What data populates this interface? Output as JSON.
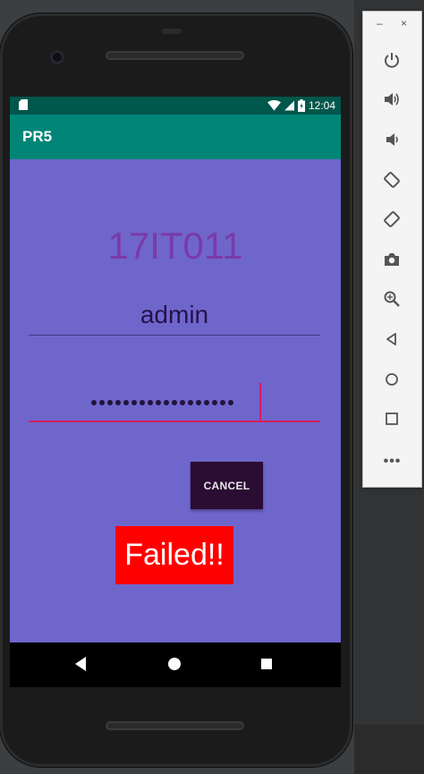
{
  "status_bar": {
    "time": "12:04",
    "icons": [
      "sd-card-icon",
      "wifi-icon",
      "signal-icon",
      "battery-icon"
    ]
  },
  "app_bar": {
    "title": "PR5"
  },
  "main": {
    "heading": "17IT011",
    "username_value": "admin",
    "password_masked_length": 18,
    "cancel_label": "CANCEL",
    "result_text": "Failed!!"
  },
  "nav_bar": {
    "icons": [
      "back-icon",
      "home-icon",
      "recents-icon"
    ]
  },
  "emulator_toolbar": {
    "window_controls": {
      "minimize": "–",
      "close": "×"
    },
    "items": [
      "power-icon",
      "volume-up-icon",
      "volume-down-icon",
      "rotate-left-icon",
      "rotate-right-icon",
      "camera-icon",
      "zoom-icon",
      "back-icon",
      "home-icon",
      "overview-icon"
    ],
    "more": "•••"
  },
  "colors": {
    "status_bar": "#00574b",
    "app_bar": "#008577",
    "content_bg": "#6f66cc",
    "heading": "#7a3aa8",
    "accent": "#d81b60",
    "cancel_button": "#2b0c33",
    "failed_bg": "#ff0000"
  }
}
